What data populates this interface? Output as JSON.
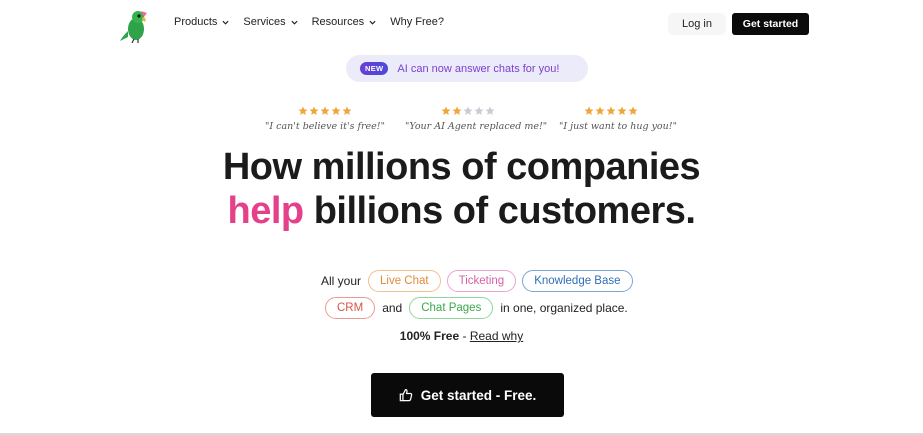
{
  "nav": {
    "items": [
      {
        "label": "Products",
        "has_dropdown": true
      },
      {
        "label": "Services",
        "has_dropdown": true
      },
      {
        "label": "Resources",
        "has_dropdown": true
      },
      {
        "label": "Why Free?",
        "has_dropdown": false
      }
    ],
    "login_label": "Log in",
    "get_started_label": "Get started"
  },
  "announcement": {
    "badge": "NEW",
    "text": "AI can now answer chats for you!"
  },
  "testimonials": [
    {
      "rating": 5,
      "quote": "\"I can't believe it's free!\""
    },
    {
      "rating": 2,
      "quote": "\"Your AI Agent replaced me!\""
    },
    {
      "rating": 5,
      "quote": "\"I just want to hug you!\""
    }
  ],
  "headline": {
    "line1": "How millions of companies",
    "line2_highlight": "help",
    "line2_rest": " billions of customers."
  },
  "features": {
    "prefix": "All your",
    "tags_line1": [
      "Live Chat",
      "Ticketing",
      "Knowledge Base"
    ],
    "tag_crm": "CRM",
    "and": "and",
    "tag_chat_pages": "Chat Pages",
    "suffix": "in one, organized place."
  },
  "free_note": {
    "bold": "100% Free",
    "sep": " - ",
    "link": "Read why"
  },
  "cta": {
    "label": "Get started - Free.",
    "icon": "thumbs-up-icon"
  },
  "colors": {
    "accent_pink": "#e5418b",
    "star_gold": "#f0a73a",
    "cta_bg": "#0a0a0a"
  }
}
